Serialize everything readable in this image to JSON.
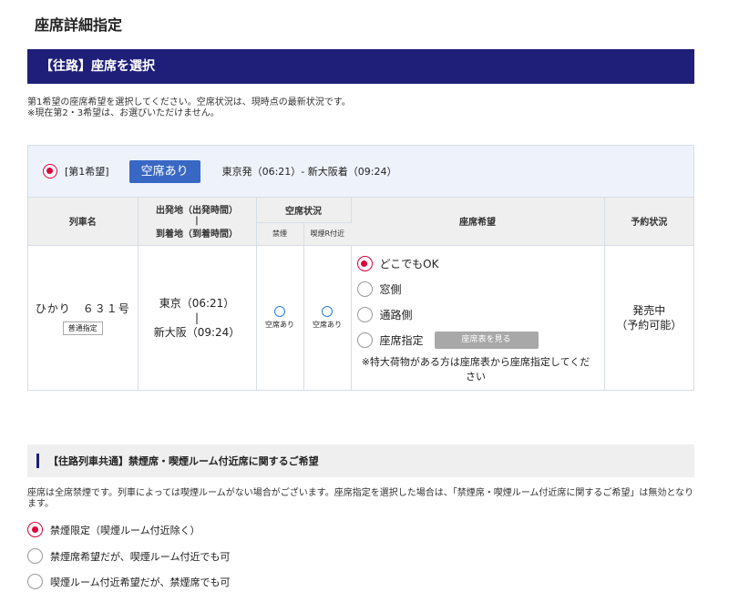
{
  "page": {
    "title": "座席詳細指定"
  },
  "banner": {
    "title": "【往路】座席を選択"
  },
  "intro": {
    "line1": "第1希望の座席希望を選択してください。空席状況は、現時点の最新状況です。",
    "line2": "※現在第2・3希望は、お選びいただけません。"
  },
  "choice": {
    "label": "[第1希望]",
    "availability_button": "空席あり",
    "route": "東京発（06:21）- 新大阪着（09:24）",
    "selected": true
  },
  "table": {
    "headers": {
      "train": "列車名",
      "stations_top": "出発地（出発時間）",
      "stations_sep": "|",
      "stations_bottom": "到着地（到着時間）",
      "vacancy": "空席状況",
      "vacancy_sub1": "禁煙",
      "vacancy_sub2": "喫煙R付近",
      "preference": "座席希望",
      "reservation": "予約状況"
    },
    "row": {
      "train_name": "ひかり　６３１号",
      "train_tag": "普通指定",
      "depart": "東京（06:21）",
      "sep": "|",
      "arrive": "新大阪（09:24）",
      "vacancy1_text": "空席あり",
      "vacancy2_text": "空席あり",
      "status_line1": "発売中",
      "status_line2": "（予約可能）"
    },
    "preferences": [
      {
        "label": "どこでもOK",
        "selected": true
      },
      {
        "label": "窓側",
        "selected": false
      },
      {
        "label": "通路側",
        "selected": false
      },
      {
        "label": "座席指定",
        "selected": false
      }
    ],
    "seatmap_button": "座席表を見る",
    "note": "※特大荷物がある方は座席表から座席指定してください"
  },
  "smoking": {
    "title": "【往路列車共通】禁煙席・喫煙ルーム付近席に関するご希望",
    "note": "座席は全席禁煙です。列車によっては喫煙ルームがない場合がございます。座席指定を選択した場合は、「禁煙席・喫煙ルーム付近席に関するご希望」は無効となります。",
    "options": [
      {
        "label": "禁煙限定（喫煙ルーム付近除く）",
        "selected": true
      },
      {
        "label": "禁煙席希望だが、喫煙ルーム付近でも可",
        "selected": false
      },
      {
        "label": "喫煙ルーム付近希望だが、禁煙席でも可",
        "selected": false
      }
    ]
  },
  "colors": {
    "banner_bg": "#1f1f7a",
    "accent_red": "#e0003c",
    "button_blue": "#3968c4",
    "vacancy_circle": "#2a7de1"
  }
}
